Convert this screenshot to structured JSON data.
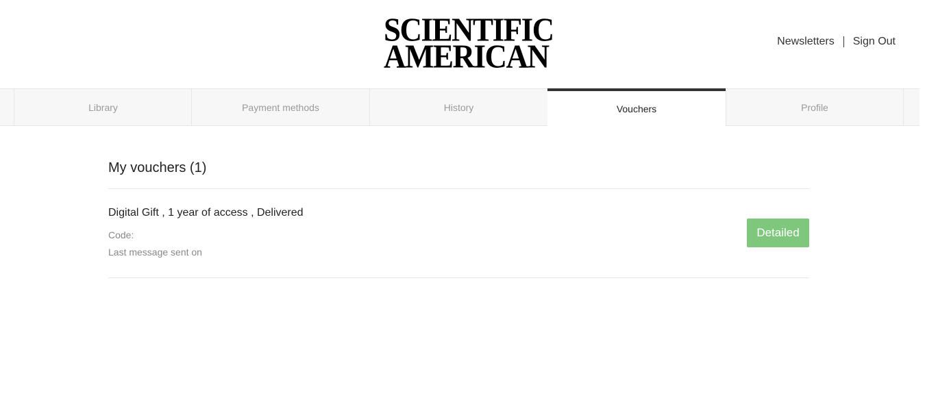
{
  "header": {
    "logo_line1": "SCIENTIFIC",
    "logo_line2": "AMERICAN",
    "newsletters_label": "Newsletters",
    "signout_label": "Sign Out"
  },
  "tabs": [
    {
      "label": "Library",
      "active": false
    },
    {
      "label": "Payment methods",
      "active": false
    },
    {
      "label": "History",
      "active": false
    },
    {
      "label": "Vouchers",
      "active": true
    },
    {
      "label": "Profile",
      "active": false
    }
  ],
  "vouchers": {
    "heading": "My vouchers (1)",
    "items": [
      {
        "title": "Digital Gift , 1 year of access , Delivered",
        "code_label": "Code:",
        "last_message_label": "Last message sent on",
        "button_label": "Detailed"
      }
    ]
  },
  "colors": {
    "accent_button": "#7fc77d",
    "active_tab_border": "#333333"
  }
}
